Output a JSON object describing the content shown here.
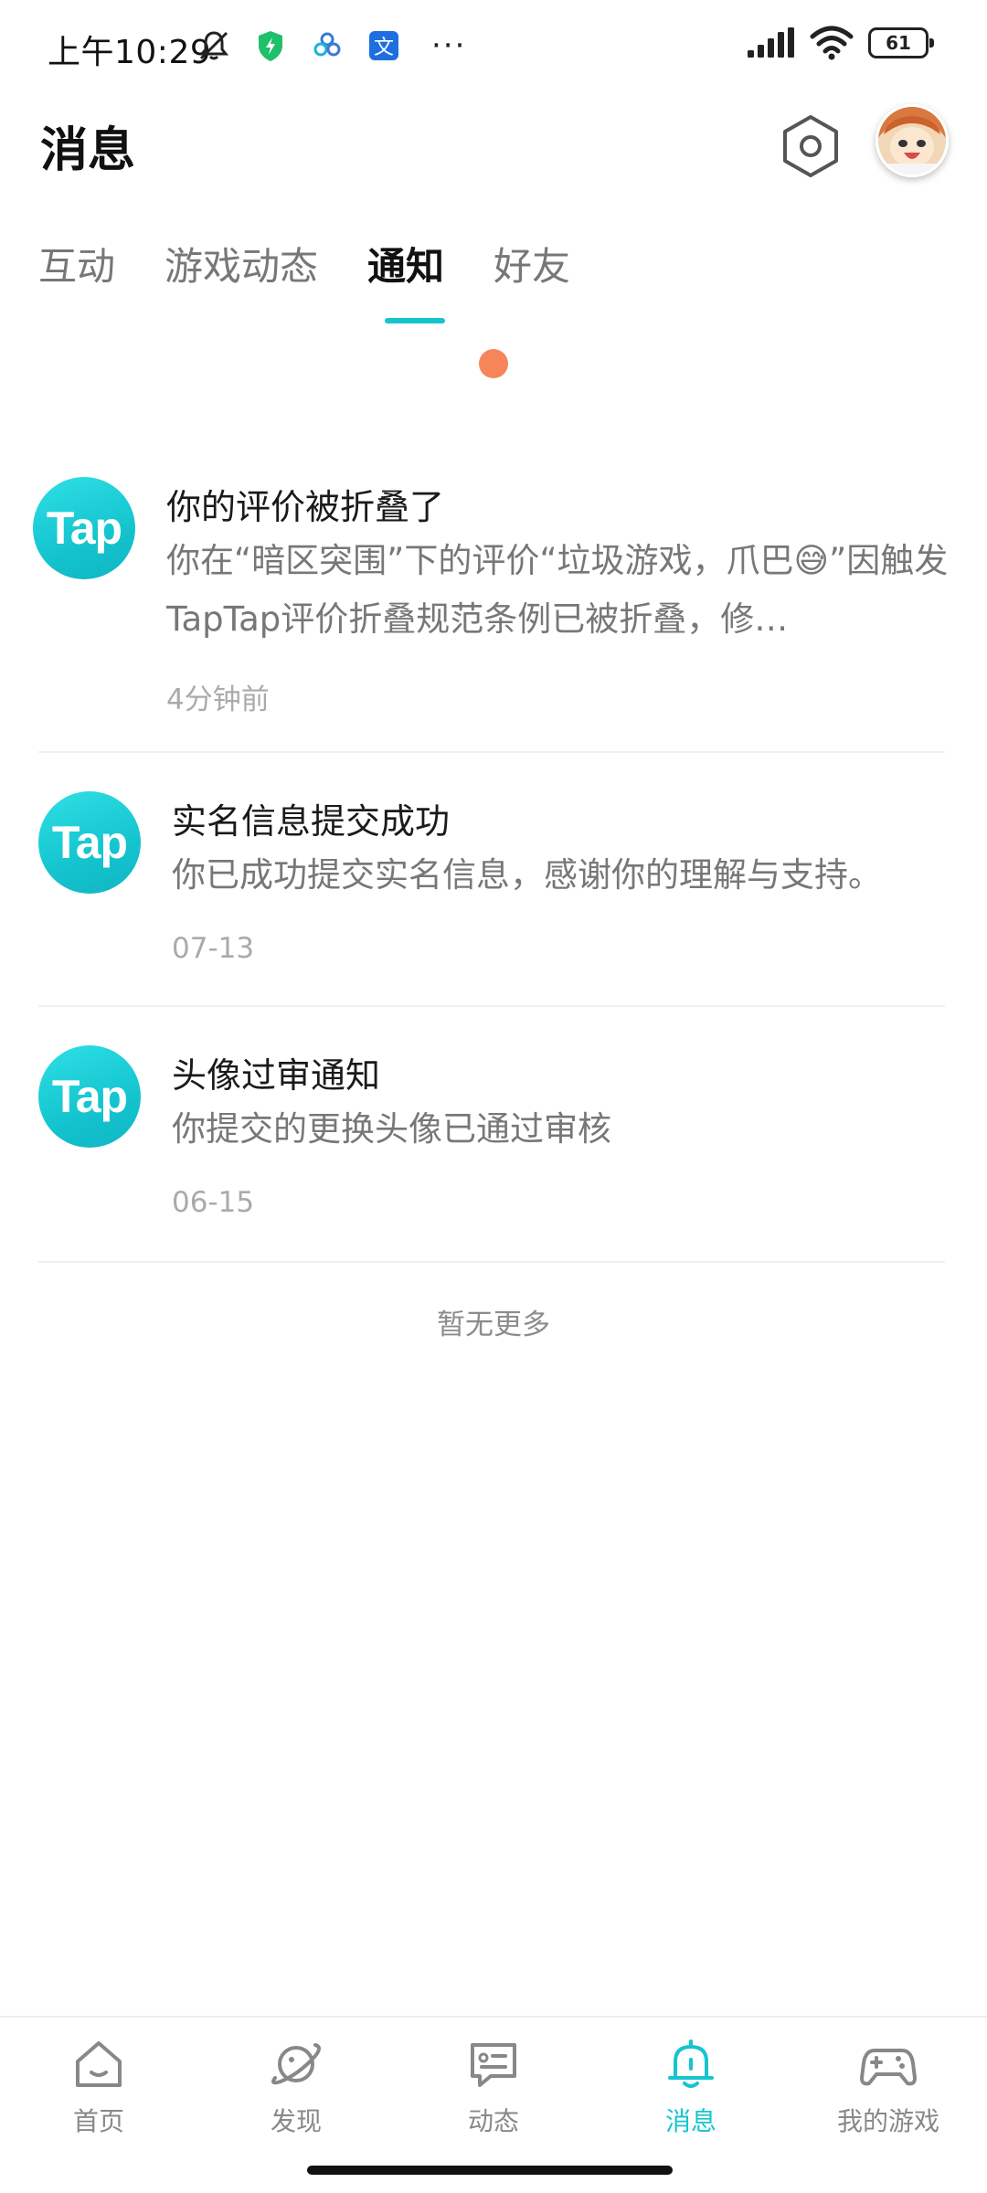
{
  "status_bar": {
    "time": "上午10:29",
    "icons_left": [
      "silent-icon",
      "shield-icon",
      "cloud-icon",
      "translate-icon"
    ],
    "more": "···",
    "icons_right": [
      "signal-icon",
      "wifi-icon"
    ],
    "battery_level": "61"
  },
  "header": {
    "title": "消息"
  },
  "tabs": [
    {
      "label": "互动",
      "active": false
    },
    {
      "label": "游戏动态",
      "active": false
    },
    {
      "label": "通知",
      "active": true
    },
    {
      "label": "好友",
      "active": false
    }
  ],
  "notifications": [
    {
      "avatar_text": "Tap",
      "title": "你的评价被折叠了",
      "body": "你在“暗区突围”下的评价“垃圾游戏，爪巴😅”因触发TapTap评价折叠规范条例已被折叠，修…",
      "time": "4分钟前"
    },
    {
      "avatar_text": "Tap",
      "title": "实名信息提交成功",
      "body": "你已成功提交实名信息，感谢你的理解与支持。",
      "time": "07-13"
    },
    {
      "avatar_text": "Tap",
      "title": "头像过审通知",
      "body": "你提交的更换头像已通过审核",
      "time": "06-15"
    }
  ],
  "list_footer": "暂无更多",
  "bottom_nav": [
    {
      "label": "首页",
      "icon": "home-icon",
      "active": false
    },
    {
      "label": "发现",
      "icon": "planet-icon",
      "active": false
    },
    {
      "label": "动态",
      "icon": "chat-icon",
      "active": false
    },
    {
      "label": "消息",
      "icon": "bell-icon",
      "active": true
    },
    {
      "label": "我的游戏",
      "icon": "gamepad-icon",
      "active": false
    }
  ],
  "colors": {
    "accent": "#15c5ce",
    "badge_dot": "#f6865a",
    "tap_logo": "#14c4cf"
  }
}
